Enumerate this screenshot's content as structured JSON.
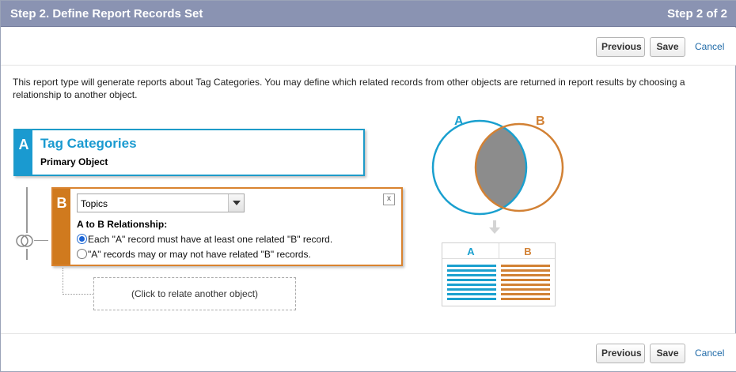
{
  "header": {
    "title": "Step 2. Define Report Records Set",
    "step": "Step 2 of 2"
  },
  "toolbar": {
    "previous_label": "Previous",
    "save_label": "Save",
    "cancel_label": "Cancel"
  },
  "intro_text": "This report type will generate reports about Tag Categories. You may define which related records from other objects are returned in report results by choosing a relationship to another object.",
  "object_a": {
    "letter": "A",
    "name": "Tag Categories",
    "subtitle": "Primary Object"
  },
  "object_b": {
    "letter": "B",
    "selected_object": "Topics",
    "close_label": "x",
    "relationship_title": "A to B Relationship:",
    "options": [
      {
        "label": "Each \"A\" record must have at least one related \"B\" record.",
        "selected": true
      },
      {
        "label": "\"A\" records may or may not have related \"B\" records.",
        "selected": false
      }
    ]
  },
  "relate_placeholder": "(Click to relate another object)",
  "venn": {
    "label_a": "A",
    "label_b": "B",
    "color_a": "#1aa0cf",
    "color_b": "#d28134",
    "overlap_color": "#8c8c8c"
  },
  "result_table": {
    "col_a": "A",
    "col_b": "B"
  },
  "colors": {
    "header_bg": "#8a93b2",
    "object_a_accent": "#1a9ad0",
    "object_b_accent": "#d07a1e",
    "link": "#1f6aa8"
  }
}
